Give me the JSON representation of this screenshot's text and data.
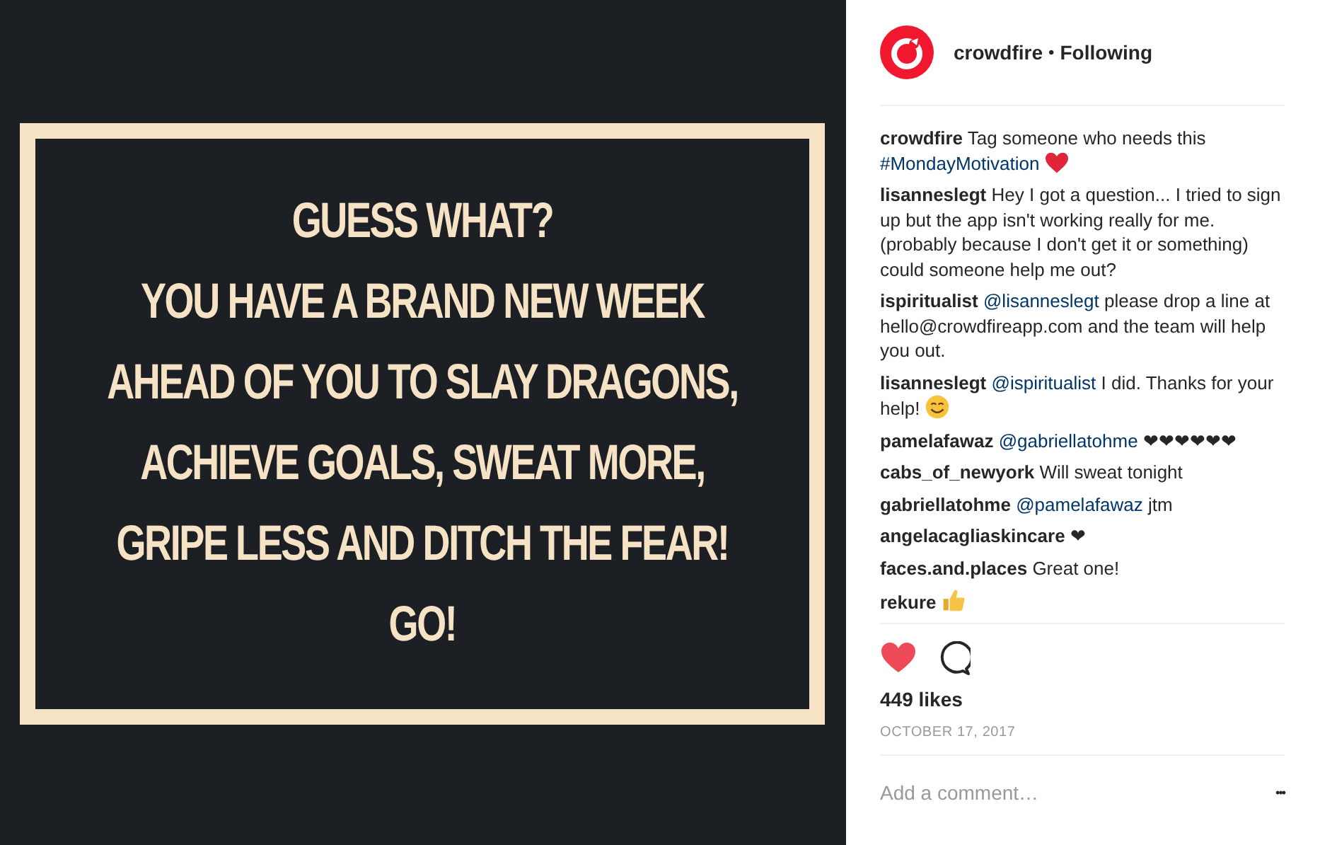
{
  "post_image": {
    "lines": [
      "GUESS WHAT?",
      "YOU HAVE A BRAND NEW WEEK",
      "AHEAD OF YOU TO SLAY DRAGONS,",
      "ACHIEVE GOALS, SWEAT MORE,",
      "GRIPE LESS AND DITCH THE FEAR!",
      "GO!"
    ]
  },
  "header": {
    "username": "crowdfire",
    "separator": "•",
    "follow_status": "Following"
  },
  "comments": [
    {
      "user": "crowdfire",
      "parts": [
        {
          "kind": "text",
          "text": "Tag someone who needs this"
        },
        {
          "kind": "link",
          "text": "#MondayMotivation"
        },
        {
          "kind": "red_heart"
        }
      ]
    },
    {
      "user": "lisanneslegt",
      "parts": [
        {
          "kind": "text",
          "text": "Hey I got a question... I tried to sign up but the app isn't working really for me. (probably because I don't get it or something) could someone help me out?"
        }
      ]
    },
    {
      "user": "ispiritualist",
      "parts": [
        {
          "kind": "link",
          "text": "@lisanneslegt"
        },
        {
          "kind": "text",
          "text": "please drop a line at hello@crowdfireapp.com and the team will help you out."
        }
      ]
    },
    {
      "user": "lisanneslegt",
      "parts": [
        {
          "kind": "link",
          "text": "@ispiritualist"
        },
        {
          "kind": "text",
          "text": "I did. Thanks for your help!"
        },
        {
          "kind": "smile"
        }
      ]
    },
    {
      "user": "pamelafawaz",
      "parts": [
        {
          "kind": "link",
          "text": "@gabriellatohme"
        },
        {
          "kind": "text",
          "text": "❤❤❤❤❤❤"
        }
      ]
    },
    {
      "user": "cabs_of_newyork",
      "parts": [
        {
          "kind": "text",
          "text": "Will sweat tonight"
        }
      ]
    },
    {
      "user": "gabriellatohme",
      "parts": [
        {
          "kind": "link",
          "text": "@pamelafawaz"
        },
        {
          "kind": "text",
          "text": "jtm"
        }
      ]
    },
    {
      "user": "angelacagliaskincare",
      "parts": [
        {
          "kind": "text",
          "text": "❤"
        }
      ]
    },
    {
      "user": "faces.and.places",
      "parts": [
        {
          "kind": "text",
          "text": "Great one!"
        }
      ]
    },
    {
      "user": "rekure",
      "parts": [
        {
          "kind": "thumbs_up"
        }
      ]
    }
  ],
  "actions": {
    "liked": true
  },
  "likes": "449 likes",
  "date": "OCTOBER 17, 2017",
  "comment_box": {
    "placeholder": "Add a comment…",
    "more": "•••"
  }
}
